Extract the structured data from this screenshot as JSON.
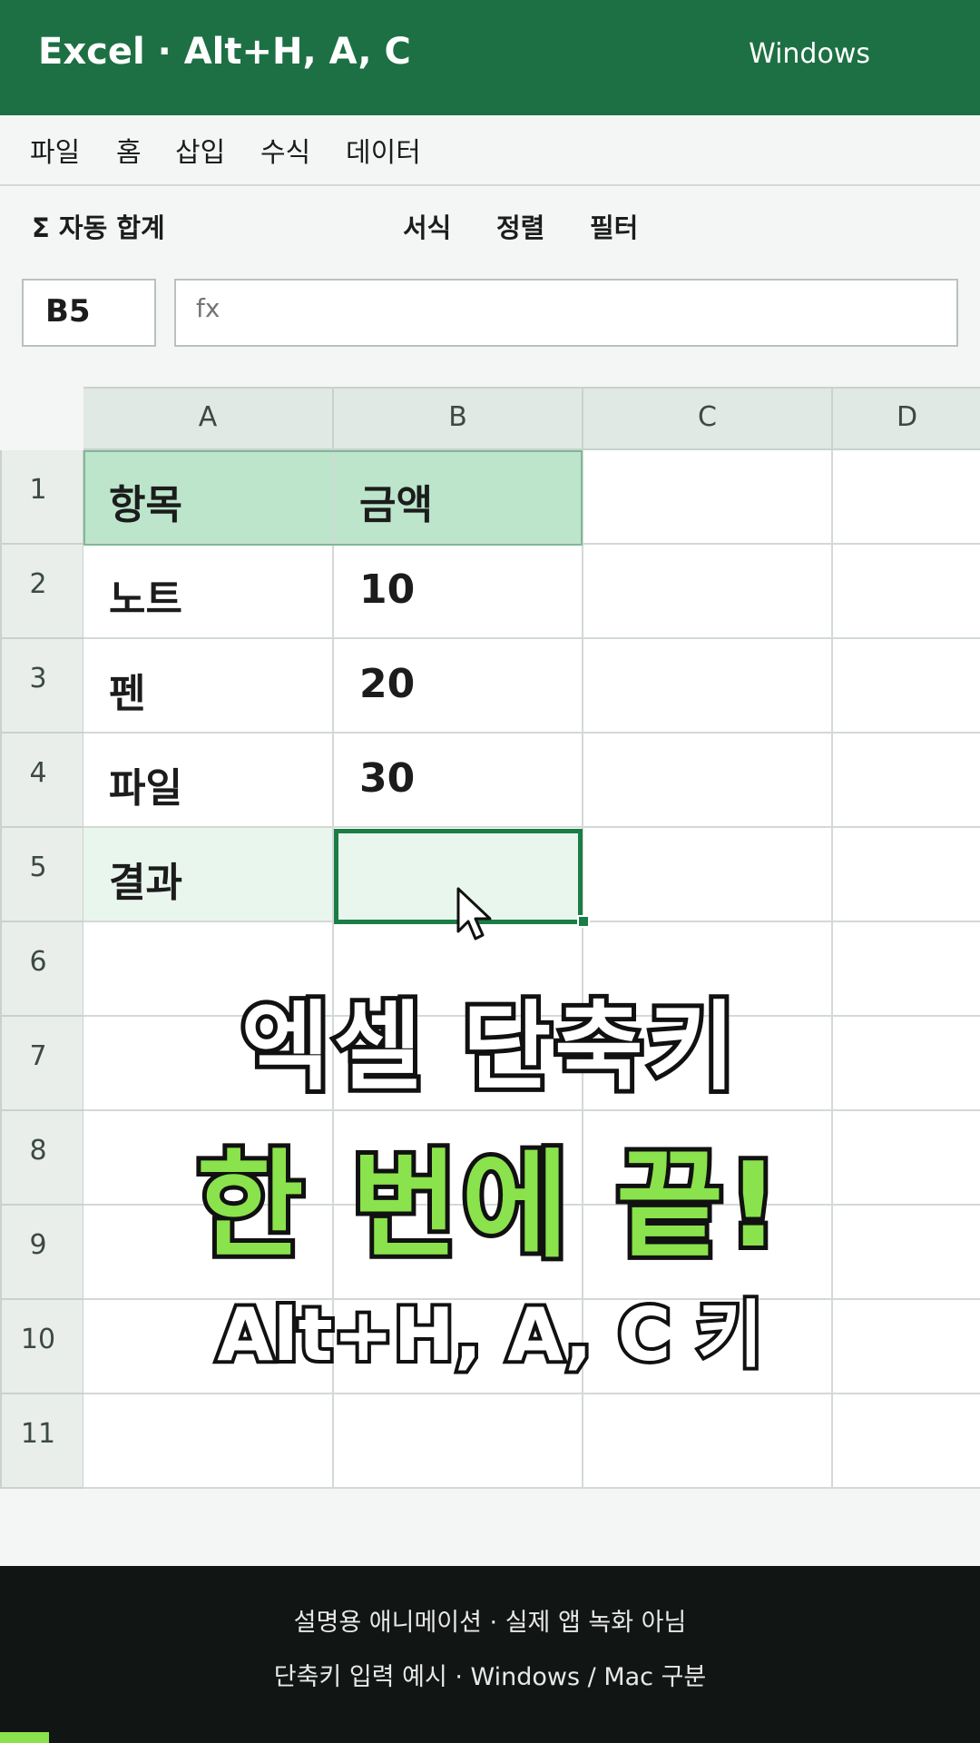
{
  "titlebar": {
    "title": "Excel · Alt+H, A, C",
    "os": "Windows"
  },
  "menu": [
    "파일",
    "홈",
    "삽입",
    "수식",
    "데이터"
  ],
  "ribbon": {
    "autosum": "Σ 자동 합계",
    "format": "서식",
    "sort": "정렬",
    "filter": "필터"
  },
  "formula_bar": {
    "name_box": "B5",
    "fx": "fx"
  },
  "columns": [
    "A",
    "B",
    "C",
    "D"
  ],
  "rows": [
    "1",
    "2",
    "3",
    "4",
    "5",
    "6",
    "7",
    "8",
    "9",
    "10",
    "11"
  ],
  "cells": {
    "A1": "항목",
    "B1": "금액",
    "A2": "노트",
    "B2": "10",
    "A3": "펜",
    "B3": "20",
    "A4": "파일",
    "B4": "30",
    "A5": "결과",
    "B5": ""
  },
  "overlay": {
    "line1": "엑셀 단축키",
    "line2": "한 번에 끝!",
    "line3": "Alt+H, A, C 키"
  },
  "footer": {
    "line1": "설명용 애니메이션 · 실제 앱 녹화 아님",
    "line2": "단축키 입력 예시 · Windows / Mac 구분",
    "progress": 0.05
  },
  "colors": {
    "accent": "#1d7044",
    "header_fill": "#bce5cb",
    "highlight": "#8ae24c"
  }
}
